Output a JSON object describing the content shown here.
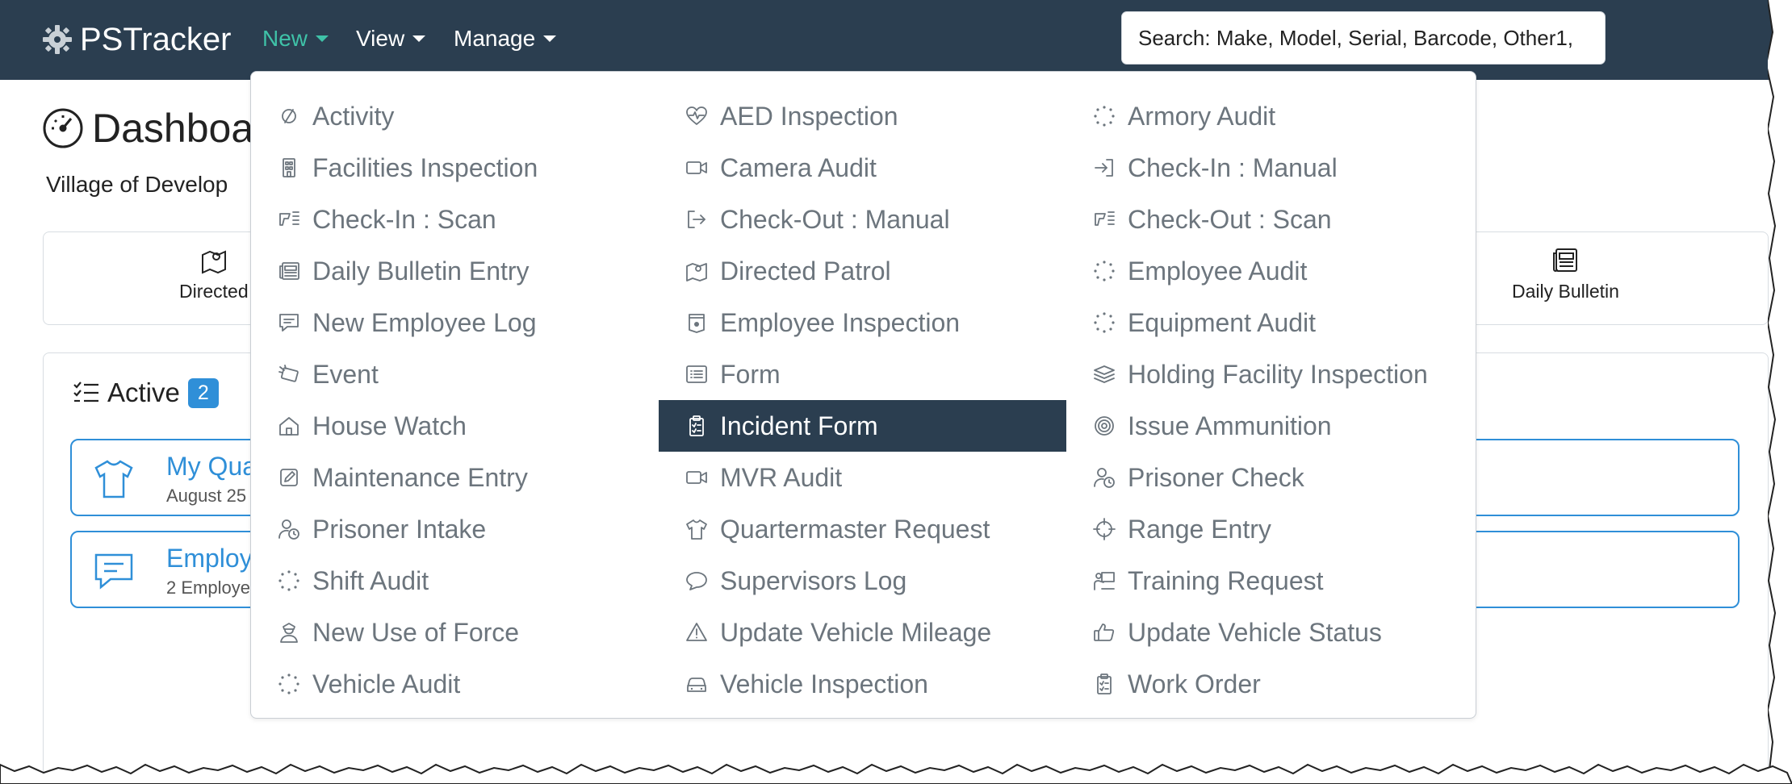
{
  "navbar": {
    "brand": "PSTracker",
    "menus": [
      {
        "label": "New",
        "active": true
      },
      {
        "label": "View",
        "active": false
      },
      {
        "label": "Manage",
        "active": false
      }
    ],
    "search_placeholder": "Search: Make, Model, Serial, Barcode, Other1,"
  },
  "page": {
    "title": "Dashboa",
    "subtitle": "Village of Develop",
    "quick_links": [
      {
        "label": "Directed",
        "icon": "map-pin-icon"
      },
      {
        "label": "Daily Bulletin",
        "icon": "newspaper-icon"
      }
    ]
  },
  "active": {
    "title": "Active",
    "count": "2",
    "items": [
      {
        "title": "My Qua",
        "subtitle": "August 25",
        "icon": "shirt-icon"
      },
      {
        "title": "Employ",
        "subtitle": "2 Employe",
        "icon": "chat-icon"
      }
    ]
  },
  "dropdown": {
    "columns": [
      [
        {
          "label": "Activity",
          "icon": "activity-icon"
        },
        {
          "label": "Facilities Inspection",
          "icon": "building-icon"
        },
        {
          "label": "Check-In : Scan",
          "icon": "scanner-icon"
        },
        {
          "label": "Daily Bulletin Entry",
          "icon": "newspaper-icon"
        },
        {
          "label": "New Employee Log",
          "icon": "chat-icon"
        },
        {
          "label": "Event",
          "icon": "event-icon"
        },
        {
          "label": "House Watch",
          "icon": "house-icon"
        },
        {
          "label": "Maintenance Entry",
          "icon": "edit-icon"
        },
        {
          "label": "Prisoner Intake",
          "icon": "person-clock-icon"
        },
        {
          "label": "Shift Audit",
          "icon": "dotted-circle-icon"
        },
        {
          "label": "New Use of Force",
          "icon": "officer-icon"
        },
        {
          "label": "Vehicle Audit",
          "icon": "dotted-circle-icon"
        }
      ],
      [
        {
          "label": "AED Inspection",
          "icon": "heart-pulse-icon"
        },
        {
          "label": "Camera Audit",
          "icon": "video-camera-icon"
        },
        {
          "label": "Check-Out : Manual",
          "icon": "sign-out-icon"
        },
        {
          "label": "Directed Patrol",
          "icon": "map-pin-icon"
        },
        {
          "label": "Employee Inspection",
          "icon": "badge-icon"
        },
        {
          "label": "Form",
          "icon": "list-icon"
        },
        {
          "label": "Incident Form",
          "icon": "clipboard-icon",
          "selected": true
        },
        {
          "label": "MVR Audit",
          "icon": "video-camera-icon"
        },
        {
          "label": "Quartermaster Request",
          "icon": "shirt-icon"
        },
        {
          "label": "Supervisors Log",
          "icon": "speech-bubble-icon"
        },
        {
          "label": "Update Vehicle Mileage",
          "icon": "warning-icon"
        },
        {
          "label": "Vehicle Inspection",
          "icon": "car-icon"
        }
      ],
      [
        {
          "label": "Armory Audit",
          "icon": "dotted-circle-icon"
        },
        {
          "label": "Check-In : Manual",
          "icon": "sign-in-icon"
        },
        {
          "label": "Check-Out : Scan",
          "icon": "scanner-icon"
        },
        {
          "label": "Employee Audit",
          "icon": "dotted-circle-icon"
        },
        {
          "label": "Equipment Audit",
          "icon": "dotted-circle-icon"
        },
        {
          "label": "Holding Facility Inspection",
          "icon": "layers-icon"
        },
        {
          "label": "Issue Ammunition",
          "icon": "target-icon"
        },
        {
          "label": "Prisoner Check",
          "icon": "person-clock-icon"
        },
        {
          "label": "Range Entry",
          "icon": "crosshair-icon"
        },
        {
          "label": "Training Request",
          "icon": "presentation-icon"
        },
        {
          "label": "Update Vehicle Status",
          "icon": "thumbs-up-icon"
        },
        {
          "label": "Work Order",
          "icon": "clipboard-icon"
        }
      ]
    ]
  },
  "colors": {
    "navbar_bg": "#2b3e50",
    "nav_active": "#3fc2a8",
    "accent": "#2f8fd8",
    "menu_text": "#6c757d"
  }
}
